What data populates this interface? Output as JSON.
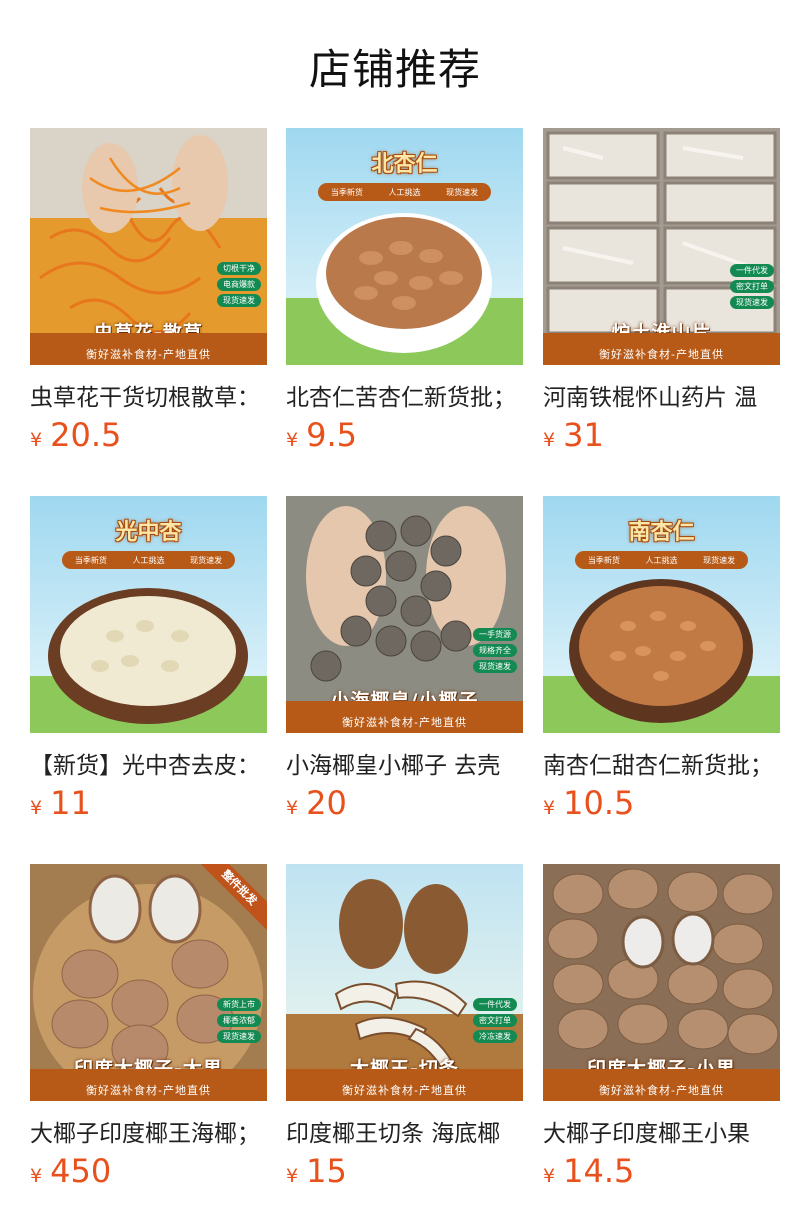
{
  "page": {
    "title": "店铺推荐"
  },
  "products": [
    {
      "name": "虫草花干货切根散草：",
      "currency": "¥",
      "price": "20.5",
      "image": {
        "caption": "虫草花-散草",
        "sub": "衡好滋补食材-产地直供",
        "badges": [
          "切根干净",
          "电商爆款",
          "现货速发"
        ]
      }
    },
    {
      "name": "北杏仁苦杏仁新货批；",
      "currency": "¥",
      "price": "9.5",
      "image": {
        "banner": "北杏仁",
        "tags": [
          "当季新货",
          "人工挑选",
          "现货速发"
        ]
      }
    },
    {
      "name": "河南铁棍怀山药片 温",
      "currency": "¥",
      "price": "31",
      "image": {
        "caption": "炉土淮山片",
        "sub": "衡好滋补食材-产地直供",
        "badges": [
          "一件代发",
          "密文打单",
          "现货速发"
        ]
      }
    },
    {
      "name": "【新货】光中杏去皮：",
      "currency": "¥",
      "price": "11",
      "image": {
        "banner": "光中杏",
        "tags": [
          "当季新货",
          "人工挑选",
          "现货速发"
        ]
      }
    },
    {
      "name": "小海椰皇小椰子 去壳",
      "currency": "¥",
      "price": "20",
      "image": {
        "caption": "小海椰皇/小椰子",
        "sub": "衡好滋补食材-产地直供",
        "badges": [
          "一手货源",
          "规格齐全",
          "现货速发"
        ]
      }
    },
    {
      "name": "南杏仁甜杏仁新货批；",
      "currency": "¥",
      "price": "10.5",
      "image": {
        "banner": "南杏仁",
        "tags": [
          "当季新货",
          "人工挑选",
          "现货速发"
        ]
      }
    },
    {
      "name": "大椰子印度椰王海椰；",
      "currency": "¥",
      "price": "450",
      "image": {
        "caption": "印度大椰子-大果",
        "sub": "衡好滋补食材-产地直供",
        "badges": [
          "新货上市",
          "椰香浓郁",
          "现货速发"
        ],
        "ribbon": "整件批发"
      }
    },
    {
      "name": "印度椰王切条 海底椰",
      "currency": "¥",
      "price": "15",
      "image": {
        "caption": "大椰王-切条",
        "sub": "衡好滋补食材-产地直供",
        "badges": [
          "一件代发",
          "密文打单",
          "冷冻速发"
        ]
      }
    },
    {
      "name": "大椰子印度椰王小果",
      "currency": "¥",
      "price": "14.5",
      "image": {
        "caption": "印度大椰子-小果",
        "sub": "衡好滋补食材-产地直供"
      }
    }
  ],
  "colors": {
    "price": "#e8501c",
    "caption_bar": "#b85a17",
    "badge": "#138a52"
  }
}
